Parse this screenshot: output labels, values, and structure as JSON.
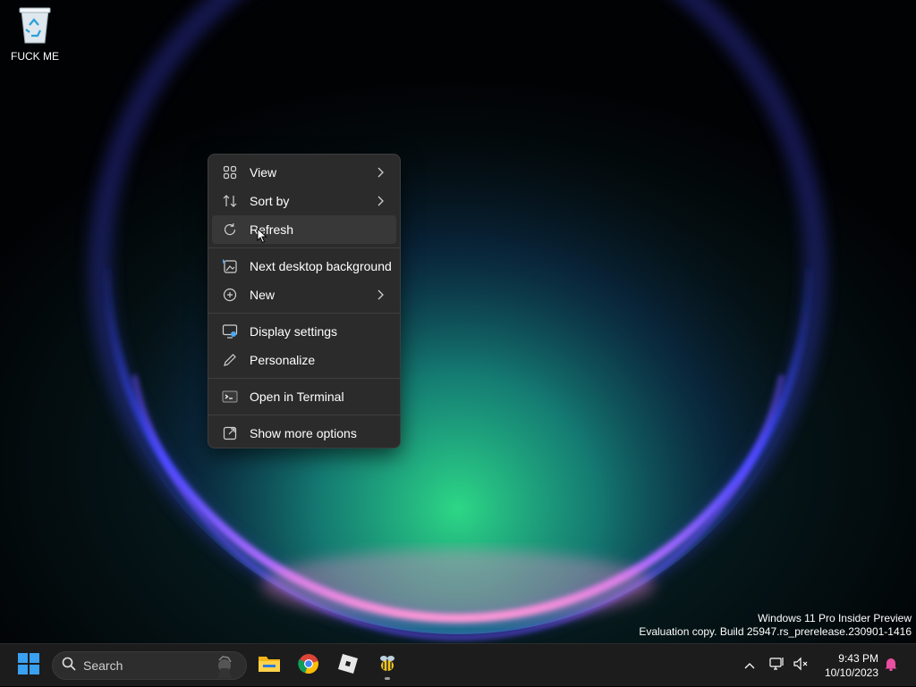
{
  "desktop": {
    "recycle_bin_label": "FUCK ME",
    "icon": "recycle-bin-icon"
  },
  "context_menu": {
    "items": [
      {
        "label": "View",
        "icon": "view-grid-icon",
        "submenu": true
      },
      {
        "label": "Sort by",
        "icon": "sort-icon",
        "submenu": true
      },
      {
        "label": "Refresh",
        "icon": "refresh-icon",
        "submenu": false
      },
      {
        "label": "Next desktop background",
        "icon": "next-background-icon",
        "submenu": false
      },
      {
        "label": "New",
        "icon": "new-plus-icon",
        "submenu": true
      },
      {
        "label": "Display settings",
        "icon": "display-settings-icon",
        "submenu": false
      },
      {
        "label": "Personalize",
        "icon": "pen-icon",
        "submenu": false
      },
      {
        "label": "Open in Terminal",
        "icon": "terminal-icon",
        "submenu": false
      },
      {
        "label": "Show more options",
        "icon": "more-options-icon",
        "submenu": false
      }
    ]
  },
  "watermark": {
    "line1": "Windows 11 Pro Insider Preview",
    "line2": "Evaluation copy. Build 25947.rs_prerelease.230901-1416"
  },
  "taskbar": {
    "search_placeholder": "Search",
    "pinned": [
      "start-icon",
      "file-explorer-icon",
      "chrome-icon",
      "roblox-icon",
      "bee-app-icon"
    ],
    "clock": {
      "time": "9:43 PM",
      "date": "10/10/2023"
    }
  },
  "colors": {
    "menu_bg": "#2b2b2b",
    "taskbar_bg": "#1c1c1c",
    "start_blue": "#3aa0f0"
  }
}
